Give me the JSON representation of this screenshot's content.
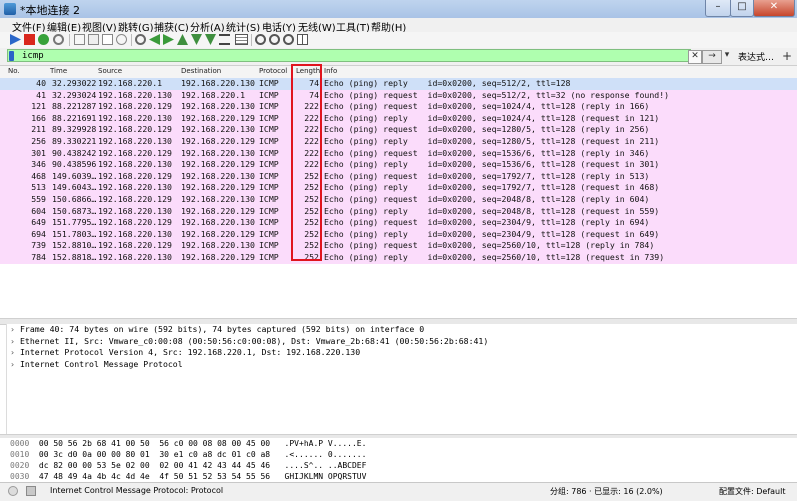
{
  "window": {
    "title": "*本地连接 2",
    "min": "–",
    "max": "□",
    "close": "✕"
  },
  "menu": [
    "文件(F)",
    "编辑(E)",
    "视图(V)",
    "跳转(G)",
    "捕获(C)",
    "分析(A)",
    "统计(S)",
    "电话(Y)",
    "无线(W)",
    "工具(T)",
    "帮助(H)"
  ],
  "filter": {
    "value": "icmp",
    "expression_label": "表达式…",
    "plus": "+"
  },
  "columns": [
    "No.",
    "Time",
    "Source",
    "Destination",
    "Protocol",
    "Length",
    "Info"
  ],
  "packets": [
    {
      "no": "40",
      "time": "32.293022",
      "src": "192.168.220.1",
      "dst": "192.168.220.130",
      "proto": "ICMP",
      "len": "74",
      "info": "Echo (ping) reply    id=0x0200, seq=512/2, ttl=128"
    },
    {
      "no": "41",
      "time": "32.293024",
      "src": "192.168.220.130",
      "dst": "192.168.220.1",
      "proto": "ICMP",
      "len": "74",
      "info": "Echo (ping) request  id=0x0200, seq=512/2, ttl=32 (no response found!)"
    },
    {
      "no": "121",
      "time": "88.221287",
      "src": "192.168.220.129",
      "dst": "192.168.220.130",
      "proto": "ICMP",
      "len": "222",
      "info": "Echo (ping) request  id=0x0200, seq=1024/4, ttl=128 (reply in 166)"
    },
    {
      "no": "166",
      "time": "88.221691",
      "src": "192.168.220.130",
      "dst": "192.168.220.129",
      "proto": "ICMP",
      "len": "222",
      "info": "Echo (ping) reply    id=0x0200, seq=1024/4, ttl=128 (request in 121)"
    },
    {
      "no": "211",
      "time": "89.329928",
      "src": "192.168.220.129",
      "dst": "192.168.220.130",
      "proto": "ICMP",
      "len": "222",
      "info": "Echo (ping) request  id=0x0200, seq=1280/5, ttl=128 (reply in 256)"
    },
    {
      "no": "256",
      "time": "89.330221",
      "src": "192.168.220.130",
      "dst": "192.168.220.129",
      "proto": "ICMP",
      "len": "222",
      "info": "Echo (ping) reply    id=0x0200, seq=1280/5, ttl=128 (request in 211)"
    },
    {
      "no": "301",
      "time": "90.438242",
      "src": "192.168.220.129",
      "dst": "192.168.220.130",
      "proto": "ICMP",
      "len": "222",
      "info": "Echo (ping) request  id=0x0200, seq=1536/6, ttl=128 (reply in 346)"
    },
    {
      "no": "346",
      "time": "90.438596",
      "src": "192.168.220.130",
      "dst": "192.168.220.129",
      "proto": "ICMP",
      "len": "222",
      "info": "Echo (ping) reply    id=0x0200, seq=1536/6, ttl=128 (request in 301)"
    },
    {
      "no": "468",
      "time": "149.6039…",
      "src": "192.168.220.129",
      "dst": "192.168.220.130",
      "proto": "ICMP",
      "len": "252",
      "info": "Echo (ping) request  id=0x0200, seq=1792/7, ttl=128 (reply in 513)"
    },
    {
      "no": "513",
      "time": "149.6043…",
      "src": "192.168.220.130",
      "dst": "192.168.220.129",
      "proto": "ICMP",
      "len": "252",
      "info": "Echo (ping) reply    id=0x0200, seq=1792/7, ttl=128 (request in 468)"
    },
    {
      "no": "559",
      "time": "150.6866…",
      "src": "192.168.220.129",
      "dst": "192.168.220.130",
      "proto": "ICMP",
      "len": "252",
      "info": "Echo (ping) request  id=0x0200, seq=2048/8, ttl=128 (reply in 604)"
    },
    {
      "no": "604",
      "time": "150.6873…",
      "src": "192.168.220.130",
      "dst": "192.168.220.129",
      "proto": "ICMP",
      "len": "252",
      "info": "Echo (ping) reply    id=0x0200, seq=2048/8, ttl=128 (request in 559)"
    },
    {
      "no": "649",
      "time": "151.7795…",
      "src": "192.168.220.129",
      "dst": "192.168.220.130",
      "proto": "ICMP",
      "len": "252",
      "info": "Echo (ping) request  id=0x0200, seq=2304/9, ttl=128 (reply in 694)"
    },
    {
      "no": "694",
      "time": "151.7803…",
      "src": "192.168.220.130",
      "dst": "192.168.220.129",
      "proto": "ICMP",
      "len": "252",
      "info": "Echo (ping) reply    id=0x0200, seq=2304/9, ttl=128 (request in 649)"
    },
    {
      "no": "739",
      "time": "152.8810…",
      "src": "192.168.220.129",
      "dst": "192.168.220.130",
      "proto": "ICMP",
      "len": "252",
      "info": "Echo (ping) request  id=0x0200, seq=2560/10, ttl=128 (reply in 784)"
    },
    {
      "no": "784",
      "time": "152.8818…",
      "src": "192.168.220.130",
      "dst": "192.168.220.129",
      "proto": "ICMP",
      "len": "252",
      "info": "Echo (ping) reply    id=0x0200, seq=2560/10, ttl=128 (request in 739)"
    }
  ],
  "details": [
    "Frame 40: 74 bytes on wire (592 bits), 74 bytes captured (592 bits) on interface 0",
    "Ethernet II, Src: Vmware_c0:00:08 (00:50:56:c0:00:08), Dst: Vmware_2b:68:41 (00:50:56:2b:68:41)",
    "Internet Protocol Version 4, Src: 192.168.220.1, Dst: 192.168.220.130",
    "Internet Control Message Protocol"
  ],
  "hex": [
    {
      "off": "0000",
      "bytes": "00 50 56 2b 68 41 00 50  56 c0 00 08 08 00 45 00",
      "ascii": ".PV+hA.P V.....E."
    },
    {
      "off": "0010",
      "bytes": "00 3c d0 0a 00 00 80 01  30 e1 c0 a8 dc 01 c0 a8",
      "ascii": ".<...... 0......."
    },
    {
      "off": "0020",
      "bytes": "dc 82 00 00 53 5e 02 00  02 00 41 42 43 44 45 46",
      "ascii": "....S^.. ..ABCDEF"
    },
    {
      "off": "0030",
      "bytes": "47 48 49 4a 4b 4c 4d 4e  4f 50 51 52 53 54 55 56",
      "ascii": "GHIJKLMN OPQRSTUV"
    }
  ],
  "status": {
    "text": "Internet Control Message Protocol: Protocol",
    "counts": "分组: 786 · 已显示: 16 (2.0%)",
    "profile": "配置文件: Default"
  }
}
